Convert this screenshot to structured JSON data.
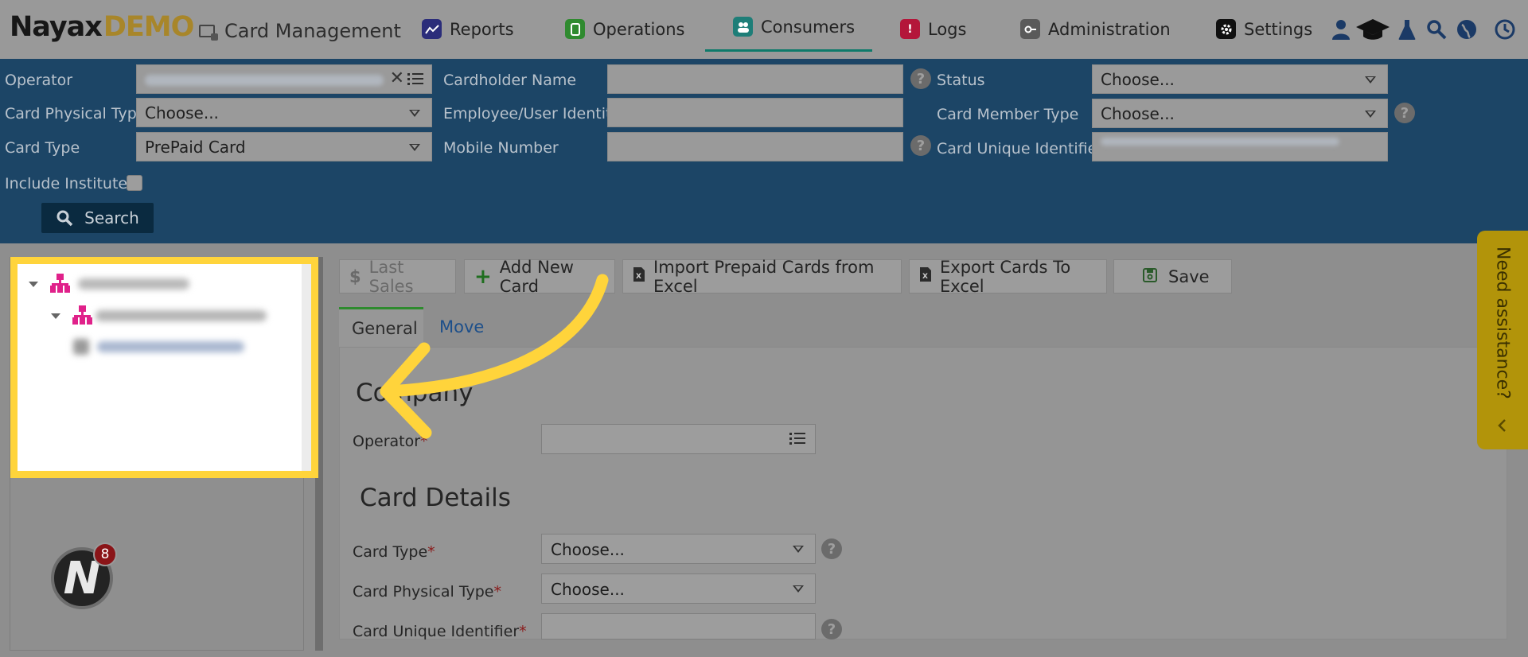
{
  "nav": {
    "logo_main": "Nayax",
    "logo_sub": "DEMO",
    "module": "Card Management",
    "items": [
      {
        "label": "Reports",
        "color": "#2b2d7a",
        "icon": "chart-icon"
      },
      {
        "label": "Operations",
        "color": "#2f8a2f",
        "icon": "device-icon"
      },
      {
        "label": "Consumers",
        "color": "#1e7e78",
        "icon": "people-icon"
      },
      {
        "label": "Logs",
        "color": "#b4163a",
        "icon": "alert-icon"
      },
      {
        "label": "Administration",
        "color": "#5a5a5a",
        "icon": "key-icon"
      },
      {
        "label": "Settings",
        "color": "#111111",
        "icon": "gear-icon"
      }
    ],
    "active": "Consumers"
  },
  "filters": {
    "operator_label": "Operator",
    "cardholder_name_label": "Cardholder Name",
    "status_label": "Status",
    "status_value": "Choose...",
    "card_physical_type_label": "Card Physical Type",
    "card_physical_type_value": "Choose...",
    "employee_identity_label": "Employee/User Identity",
    "card_member_type_label": "Card Member Type",
    "card_member_type_value": "Choose...",
    "card_type_label": "Card Type",
    "card_type_value": "PrePaid Card",
    "mobile_number_label": "Mobile Number",
    "card_unique_identifier_label": "Card Unique Identifier",
    "include_institutes_label": "Include Institutes",
    "search_label": "Search"
  },
  "toolbar": {
    "last_sales": "Last Sales",
    "add_new_card": "Add New Card",
    "import_prepaid": "Import Prepaid Cards from Excel",
    "export_cards": "Export Cards To Excel",
    "save": "Save"
  },
  "tabs": {
    "general": "General",
    "move": "Move"
  },
  "form": {
    "company_heading": "Company",
    "operator_label": "Operator",
    "card_details_heading": "Card Details",
    "card_type_label": "Card Type",
    "card_type_value": "Choose...",
    "card_physical_type_label": "Card Physical Type",
    "card_physical_type_value": "Choose...",
    "card_unique_identifier_label": "Card Unique Identifier",
    "required_mark": "*"
  },
  "notifications": {
    "count": "8"
  },
  "assistance": {
    "label": "Need assistance?"
  },
  "colors": {
    "highlight": "#ffd43b",
    "filter_panel": "#1c4566",
    "active_tab_accent": "#0e7a6a"
  }
}
